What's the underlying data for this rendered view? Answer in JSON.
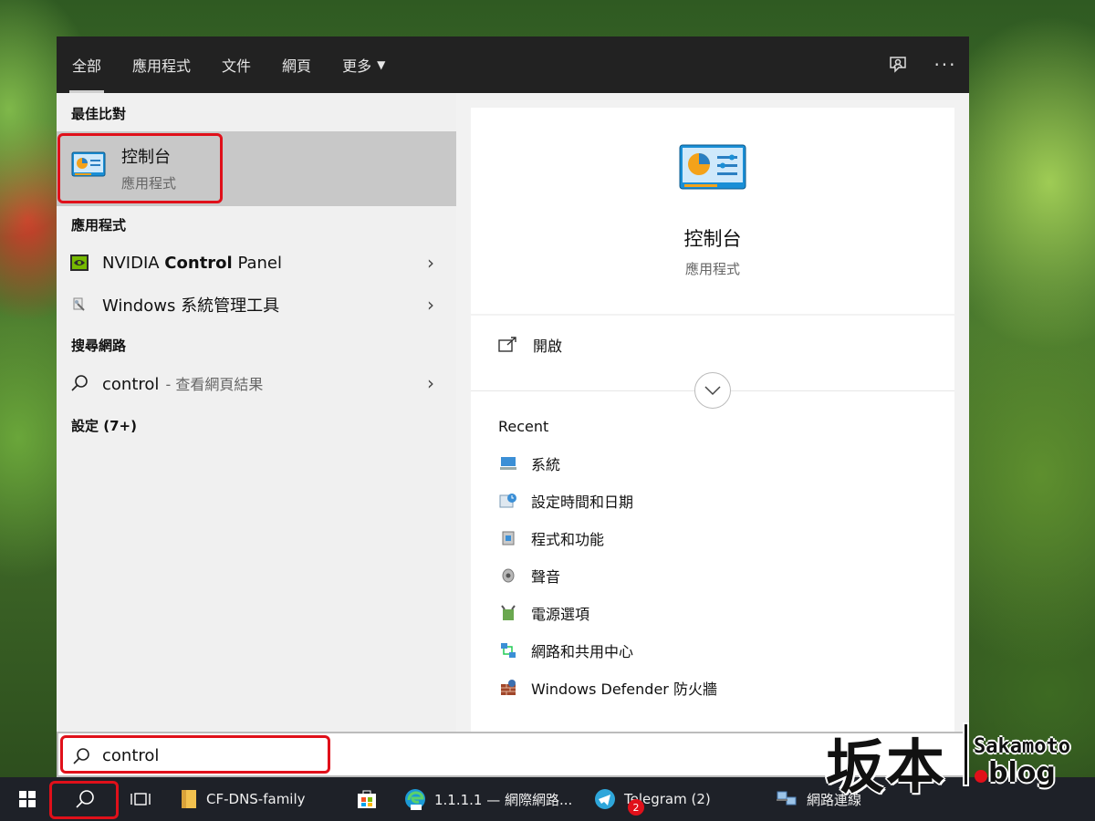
{
  "tabs": [
    {
      "label": "全部",
      "active": true
    },
    {
      "label": "應用程式"
    },
    {
      "label": "文件"
    },
    {
      "label": "網頁"
    },
    {
      "label": "更多"
    }
  ],
  "topbar_icons": [
    "feedback-icon",
    "more-options-icon"
  ],
  "left": {
    "best_match_heading": "最佳比對",
    "best_match": {
      "title": "控制台",
      "subtitle": "應用程式",
      "icon": "control-panel-icon"
    },
    "apps_heading": "應用程式",
    "apps": [
      {
        "prefix": "NVIDIA ",
        "bold": "Control",
        "suffix": " Panel",
        "icon": "nvidia-icon"
      },
      {
        "prefix": "Windows 系統管理工具",
        "bold": "",
        "suffix": "",
        "icon": "admin-tools-icon"
      }
    ],
    "web_heading": "搜尋網路",
    "web": {
      "term": "control",
      "hint": " - 查看網頁結果",
      "icon": "search-icon"
    },
    "settings_heading": "設定 (7+)"
  },
  "right": {
    "title": "控制台",
    "subtitle": "應用程式",
    "open_label": "開啟",
    "recent_heading": "Recent",
    "recent": [
      {
        "label": "系統",
        "icon": "system-icon"
      },
      {
        "label": "設定時間和日期",
        "icon": "datetime-icon"
      },
      {
        "label": "程式和功能",
        "icon": "programs-icon"
      },
      {
        "label": "聲音",
        "icon": "sound-icon"
      },
      {
        "label": "電源選項",
        "icon": "power-icon"
      },
      {
        "label": "網路和共用中心",
        "icon": "network-icon"
      },
      {
        "label": "Windows Defender 防火牆",
        "icon": "firewall-icon"
      }
    ]
  },
  "search": {
    "value": "control"
  },
  "taskbar": {
    "items": [
      {
        "label": "CF-DNS-family",
        "icon": "folder-icon"
      },
      {
        "label": "",
        "icon": "store-icon"
      },
      {
        "label": "1.1.1.1 — 網際網路...",
        "icon": "edge-beta-icon"
      },
      {
        "label": "Telegram (2)",
        "icon": "telegram-icon",
        "badge": "2"
      },
      {
        "label": "網路連線",
        "icon": "network-connections-icon"
      }
    ]
  },
  "watermark": {
    "cn": "坂本",
    "en": "Sakamoto",
    "blog": "blog"
  },
  "colors": {
    "highlight": "#e0101a",
    "taskbar": "#1e2128",
    "topbar": "#222222"
  }
}
